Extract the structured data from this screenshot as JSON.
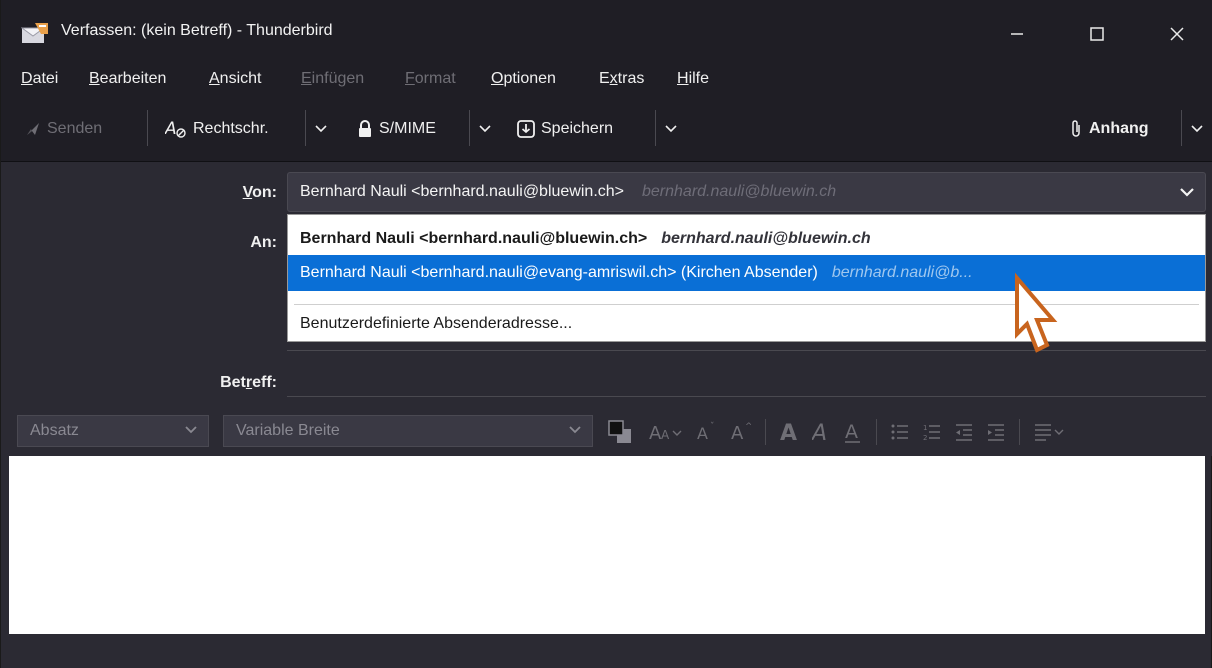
{
  "window": {
    "title": "Verfassen: (kein Betreff) - Thunderbird"
  },
  "menu": {
    "items": [
      {
        "label_u": "D",
        "label_rest": "atei",
        "disabled": false
      },
      {
        "label_u": "B",
        "label_rest": "earbeiten",
        "disabled": false
      },
      {
        "label_u": "A",
        "label_rest": "nsicht",
        "disabled": false
      },
      {
        "label_u": "E",
        "label_rest": "infügen",
        "disabled": true
      },
      {
        "label_u": "F",
        "label_rest": "ormat",
        "disabled": true
      },
      {
        "label_u": "O",
        "label_rest": "ptionen",
        "disabled": false
      },
      {
        "label_pre": "E",
        "label_u": "x",
        "label_rest": "tras",
        "disabled": false
      },
      {
        "label_u": "H",
        "label_rest": "ilfe",
        "disabled": false
      }
    ]
  },
  "toolbar": {
    "send_label": "Senden",
    "spell_label": "Rechtschr.",
    "smime_label": "S/MIME",
    "save_label": "Speichern",
    "attach_label": "Anhang"
  },
  "headers": {
    "from_label_u": "V",
    "from_label_rest": "on:",
    "to_label": "An:",
    "subject_label_pre": "Bet",
    "subject_label_u": "r",
    "subject_label_rest": "eff:",
    "from_value": "Bernhard Nauli <bernhard.nauli@bluewin.ch>",
    "from_value_sub": "bernhard.nauli@bluewin.ch"
  },
  "dropdown": {
    "items": [
      {
        "main": "Bernhard Nauli <bernhard.nauli@bluewin.ch>",
        "sub": "bernhard.nauli@bluewin.ch",
        "selected": false
      },
      {
        "main": "Bernhard Nauli <bernhard.nauli@evang-amriswil.ch> (Kirchen Absender)",
        "sub": "bernhard.nauli@b...",
        "selected": true
      },
      {
        "main": "Benutzerdefinierte Absenderadresse...",
        "sub": "",
        "selected": false
      }
    ]
  },
  "format": {
    "paragraph_value": "Absatz",
    "font_value": "Variable Breite"
  },
  "colors": {
    "accent": "#0a6fd6",
    "chrome": "#1f1e25",
    "panel": "#2b2a33"
  }
}
